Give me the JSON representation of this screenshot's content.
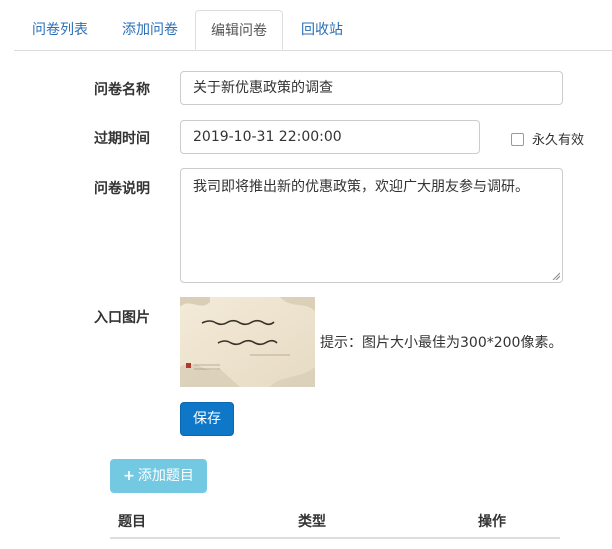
{
  "tabs": [
    {
      "label": "问卷列表"
    },
    {
      "label": "添加问卷"
    },
    {
      "label": "编辑问卷"
    },
    {
      "label": "回收站"
    }
  ],
  "form": {
    "name_label": "问卷名称",
    "name_value": "关于新优惠政策的调查",
    "expire_label": "过期时间",
    "expire_value": "2019-10-31 22:00:00",
    "forever_label": "永久有效",
    "desc_label": "问卷说明",
    "desc_value": "我司即将推出新的优惠政策，欢迎广大朋友参与调研。",
    "image_label": "入口图片",
    "image_hint": "提示：图片大小最佳为300*200像素。",
    "save_label": "保存"
  },
  "add_question_label": "添加题目",
  "table": {
    "headers": [
      "题目",
      "类型",
      "操作"
    ]
  }
}
